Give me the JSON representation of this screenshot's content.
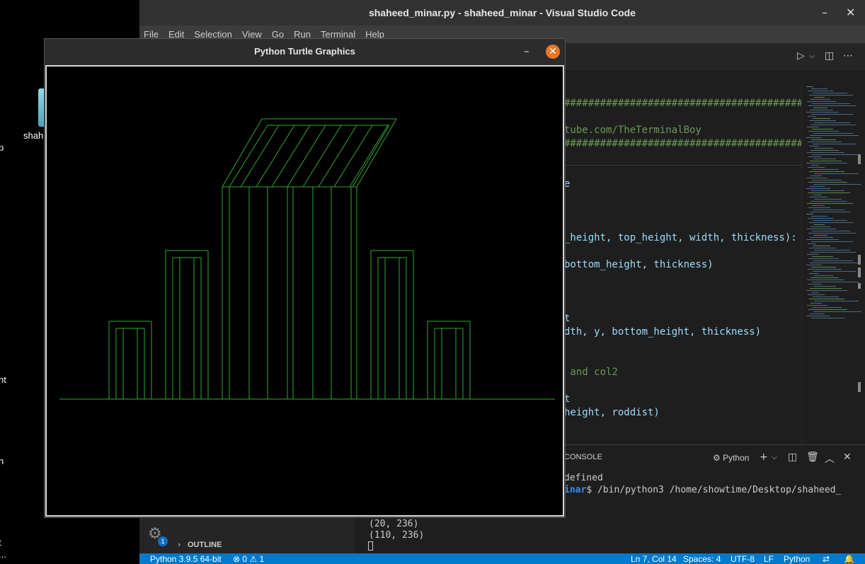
{
  "desktop": {
    "labels": [
      "shah",
      "p",
      "nt",
      "n",
      "t",
      "..."
    ]
  },
  "vscode": {
    "title": "shaheed_minar.py - shaheed_minar - Visual Studio Code",
    "minimize_icon": "–",
    "close_icon": "✕",
    "menu": [
      "File",
      "Edit",
      "Selection",
      "View",
      "Go",
      "Run",
      "Terminal",
      "Help"
    ],
    "code_lines": [
      {
        "text": "##########################################################",
        "color": "#6a9955"
      },
      {
        "text": "tube.com/TheTerminalBoy",
        "color": "#6a9955"
      },
      {
        "text": "##########################################################",
        "color": "#6a9955"
      },
      {
        "text": "e",
        "color": "#9cdcfe"
      },
      {
        "text": "_height, top_height, width, thickness):",
        "color": "#9cdcfe"
      },
      {
        "text": "bottom_height, thickness)",
        "color": "#9cdcfe"
      },
      {
        "text": "t",
        "color": "#9cdcfe"
      },
      {
        "text": "dth, y, bottom_height, thickness)",
        "color": "#9cdcfe"
      },
      {
        "text": " and col2",
        "color": "#6a9955"
      },
      {
        "text": "t",
        "color": "#9cdcfe"
      },
      {
        "text": "height, roddist)",
        "color": "#9cdcfe"
      }
    ],
    "panel": {
      "tab_label": "CONSOLE",
      "terminal_lang": "Python",
      "lines": [
        {
          "text": "defined",
          "color": "#cccccc"
        },
        {
          "prefix": "inar",
          "text": "$ /bin/python3 /home/showtime/Desktop/shaheed_",
          "prefix_color": "#3b8eea"
        }
      ]
    },
    "output_lines": [
      "(20, 236)",
      "(110, 236)"
    ],
    "outline_label": "OUTLINE",
    "gear_badge": "1",
    "status": {
      "python": "Python 3.9.5 64-bit",
      "problems": "⊗ 0 ⚠ 1",
      "position": "Ln 7, Col 14",
      "spaces": "Spaces: 4",
      "encoding": "UTF-8",
      "eol": "LF",
      "language": "Python"
    }
  },
  "turtle": {
    "title": "Python Turtle Graphics",
    "minimize_icon": "–",
    "close_icon": "✕",
    "line_color": "#2fa82f"
  }
}
